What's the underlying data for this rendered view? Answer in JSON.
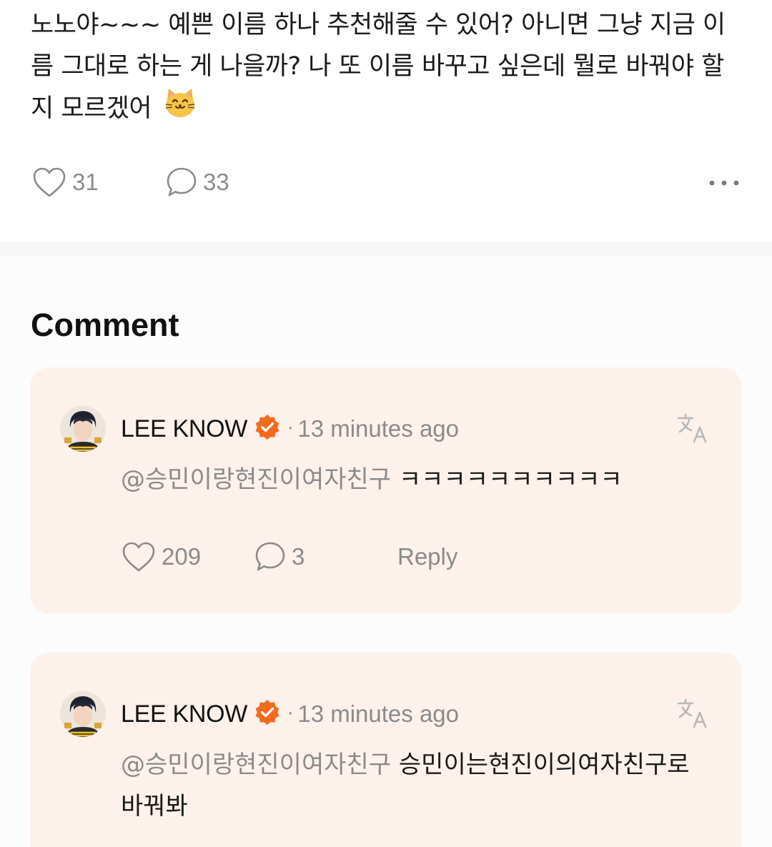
{
  "post": {
    "text": "노노야~~~ 예쁜 이름 하나 추천해줄 수 있어? 아니면 그냥 지금 이름 그대로 하는 게 나을까? 나 또 이름 바꾸고 싶은데 뭘로 바꿔야 할지 모르겠어",
    "emoji": "cat-face-emoji",
    "likes": "31",
    "comments": "33"
  },
  "comments_section": {
    "heading": "Comment",
    "items": [
      {
        "author": "LEE KNOW",
        "separator": "·",
        "time": "13 minutes ago",
        "mention": "@승민이랑현진이여자친구",
        "text": "ㅋㅋㅋㅋㅋㅋㅋㅋㅋㅋ",
        "likes": "209",
        "replies": "3",
        "reply_label": "Reply"
      },
      {
        "author": "LEE KNOW",
        "separator": "·",
        "time": "13 minutes ago",
        "mention": "@승민이랑현진이여자친구",
        "text": "승민이는현진이의여자친구로 바꿔봐"
      }
    ]
  },
  "colors": {
    "card_bg": "#fdf1ec",
    "verified_badge": "#f26b1d",
    "muted_text": "#8a8a8a"
  }
}
